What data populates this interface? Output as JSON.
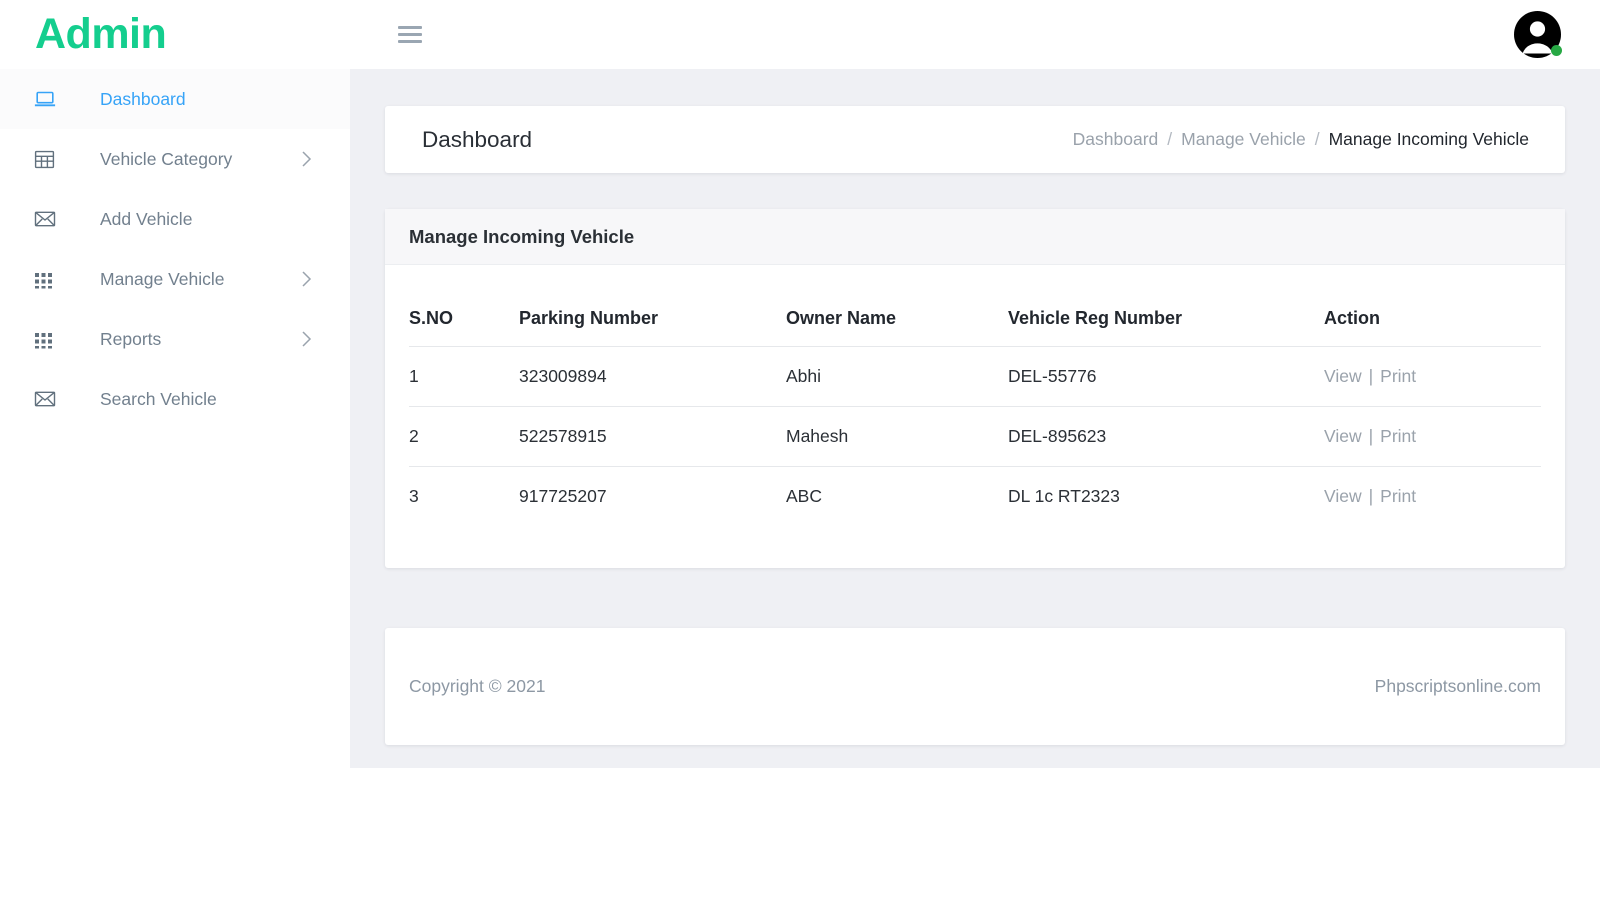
{
  "brand": {
    "text": "Admin"
  },
  "topbar": {
    "menu_icon": "hamburger-icon",
    "avatar_icon": "user-avatar-icon",
    "status": "online"
  },
  "sidebar": {
    "items": [
      {
        "label": "Dashboard",
        "icon": "laptop-icon",
        "active": true,
        "has_arrow": false
      },
      {
        "label": "Vehicle Category",
        "icon": "table-icon",
        "active": false,
        "has_arrow": true
      },
      {
        "label": "Add Vehicle",
        "icon": "envelope-icon",
        "active": false,
        "has_arrow": false
      },
      {
        "label": "Manage Vehicle",
        "icon": "grid-dots-icon",
        "active": false,
        "has_arrow": true
      },
      {
        "label": "Reports",
        "icon": "grid-dots-icon",
        "active": false,
        "has_arrow": true
      },
      {
        "label": "Search Vehicle",
        "icon": "envelope-icon",
        "active": false,
        "has_arrow": false
      }
    ]
  },
  "page": {
    "title": "Dashboard",
    "breadcrumb": [
      {
        "label": "Dashboard",
        "current": false
      },
      {
        "label": "Manage Vehicle",
        "current": false
      },
      {
        "label": "Manage Incoming Vehicle",
        "current": true
      }
    ],
    "breadcrumb_separator": "/"
  },
  "card": {
    "title": "Manage Incoming Vehicle",
    "table": {
      "headers": [
        "S.NO",
        "Parking Number",
        "Owner Name",
        "Vehicle Reg Number",
        "Action"
      ],
      "rows": [
        {
          "sno": "1",
          "parking_number": "323009894",
          "owner_name": "Abhi",
          "vehicle_reg_number": "DEL-55776",
          "view_label": "View",
          "separator": "|",
          "print_label": "Print"
        },
        {
          "sno": "2",
          "parking_number": "522578915",
          "owner_name": "Mahesh",
          "vehicle_reg_number": "DEL-895623",
          "view_label": "View",
          "separator": "|",
          "print_label": "Print"
        },
        {
          "sno": "3",
          "parking_number": "917725207",
          "owner_name": "ABC",
          "vehicle_reg_number": "DL 1c RT2323",
          "view_label": "View",
          "separator": "|",
          "print_label": "Print"
        }
      ]
    }
  },
  "footer": {
    "copyright": "Copyright © 2021",
    "site": "Phpscriptsonline.com"
  },
  "colors": {
    "brand_green": "#14ce8e",
    "active_blue": "#36a3f7",
    "muted": "#9aa2ab",
    "page_bg": "#eff0f4",
    "status_green": "#27a844"
  }
}
